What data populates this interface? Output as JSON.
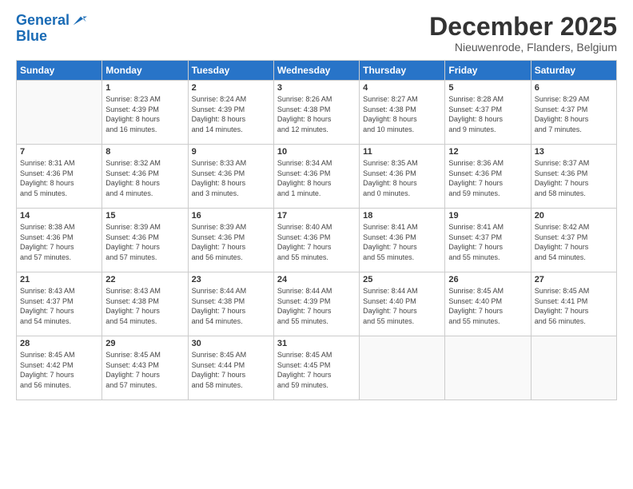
{
  "header": {
    "logo_line1": "General",
    "logo_line2": "Blue",
    "title": "December 2025",
    "subtitle": "Nieuwenrode, Flanders, Belgium"
  },
  "days_of_week": [
    "Sunday",
    "Monday",
    "Tuesday",
    "Wednesday",
    "Thursday",
    "Friday",
    "Saturday"
  ],
  "weeks": [
    [
      {
        "day": "",
        "info": ""
      },
      {
        "day": "1",
        "info": "Sunrise: 8:23 AM\nSunset: 4:39 PM\nDaylight: 8 hours\nand 16 minutes."
      },
      {
        "day": "2",
        "info": "Sunrise: 8:24 AM\nSunset: 4:39 PM\nDaylight: 8 hours\nand 14 minutes."
      },
      {
        "day": "3",
        "info": "Sunrise: 8:26 AM\nSunset: 4:38 PM\nDaylight: 8 hours\nand 12 minutes."
      },
      {
        "day": "4",
        "info": "Sunrise: 8:27 AM\nSunset: 4:38 PM\nDaylight: 8 hours\nand 10 minutes."
      },
      {
        "day": "5",
        "info": "Sunrise: 8:28 AM\nSunset: 4:37 PM\nDaylight: 8 hours\nand 9 minutes."
      },
      {
        "day": "6",
        "info": "Sunrise: 8:29 AM\nSunset: 4:37 PM\nDaylight: 8 hours\nand 7 minutes."
      }
    ],
    [
      {
        "day": "7",
        "info": "Sunrise: 8:31 AM\nSunset: 4:36 PM\nDaylight: 8 hours\nand 5 minutes."
      },
      {
        "day": "8",
        "info": "Sunrise: 8:32 AM\nSunset: 4:36 PM\nDaylight: 8 hours\nand 4 minutes."
      },
      {
        "day": "9",
        "info": "Sunrise: 8:33 AM\nSunset: 4:36 PM\nDaylight: 8 hours\nand 3 minutes."
      },
      {
        "day": "10",
        "info": "Sunrise: 8:34 AM\nSunset: 4:36 PM\nDaylight: 8 hours\nand 1 minute."
      },
      {
        "day": "11",
        "info": "Sunrise: 8:35 AM\nSunset: 4:36 PM\nDaylight: 8 hours\nand 0 minutes."
      },
      {
        "day": "12",
        "info": "Sunrise: 8:36 AM\nSunset: 4:36 PM\nDaylight: 7 hours\nand 59 minutes."
      },
      {
        "day": "13",
        "info": "Sunrise: 8:37 AM\nSunset: 4:36 PM\nDaylight: 7 hours\nand 58 minutes."
      }
    ],
    [
      {
        "day": "14",
        "info": "Sunrise: 8:38 AM\nSunset: 4:36 PM\nDaylight: 7 hours\nand 57 minutes."
      },
      {
        "day": "15",
        "info": "Sunrise: 8:39 AM\nSunset: 4:36 PM\nDaylight: 7 hours\nand 57 minutes."
      },
      {
        "day": "16",
        "info": "Sunrise: 8:39 AM\nSunset: 4:36 PM\nDaylight: 7 hours\nand 56 minutes."
      },
      {
        "day": "17",
        "info": "Sunrise: 8:40 AM\nSunset: 4:36 PM\nDaylight: 7 hours\nand 55 minutes."
      },
      {
        "day": "18",
        "info": "Sunrise: 8:41 AM\nSunset: 4:36 PM\nDaylight: 7 hours\nand 55 minutes."
      },
      {
        "day": "19",
        "info": "Sunrise: 8:41 AM\nSunset: 4:37 PM\nDaylight: 7 hours\nand 55 minutes."
      },
      {
        "day": "20",
        "info": "Sunrise: 8:42 AM\nSunset: 4:37 PM\nDaylight: 7 hours\nand 54 minutes."
      }
    ],
    [
      {
        "day": "21",
        "info": "Sunrise: 8:43 AM\nSunset: 4:37 PM\nDaylight: 7 hours\nand 54 minutes."
      },
      {
        "day": "22",
        "info": "Sunrise: 8:43 AM\nSunset: 4:38 PM\nDaylight: 7 hours\nand 54 minutes."
      },
      {
        "day": "23",
        "info": "Sunrise: 8:44 AM\nSunset: 4:38 PM\nDaylight: 7 hours\nand 54 minutes."
      },
      {
        "day": "24",
        "info": "Sunrise: 8:44 AM\nSunset: 4:39 PM\nDaylight: 7 hours\nand 55 minutes."
      },
      {
        "day": "25",
        "info": "Sunrise: 8:44 AM\nSunset: 4:40 PM\nDaylight: 7 hours\nand 55 minutes."
      },
      {
        "day": "26",
        "info": "Sunrise: 8:45 AM\nSunset: 4:40 PM\nDaylight: 7 hours\nand 55 minutes."
      },
      {
        "day": "27",
        "info": "Sunrise: 8:45 AM\nSunset: 4:41 PM\nDaylight: 7 hours\nand 56 minutes."
      }
    ],
    [
      {
        "day": "28",
        "info": "Sunrise: 8:45 AM\nSunset: 4:42 PM\nDaylight: 7 hours\nand 56 minutes."
      },
      {
        "day": "29",
        "info": "Sunrise: 8:45 AM\nSunset: 4:43 PM\nDaylight: 7 hours\nand 57 minutes."
      },
      {
        "day": "30",
        "info": "Sunrise: 8:45 AM\nSunset: 4:44 PM\nDaylight: 7 hours\nand 58 minutes."
      },
      {
        "day": "31",
        "info": "Sunrise: 8:45 AM\nSunset: 4:45 PM\nDaylight: 7 hours\nand 59 minutes."
      },
      {
        "day": "",
        "info": ""
      },
      {
        "day": "",
        "info": ""
      },
      {
        "day": "",
        "info": ""
      }
    ]
  ]
}
